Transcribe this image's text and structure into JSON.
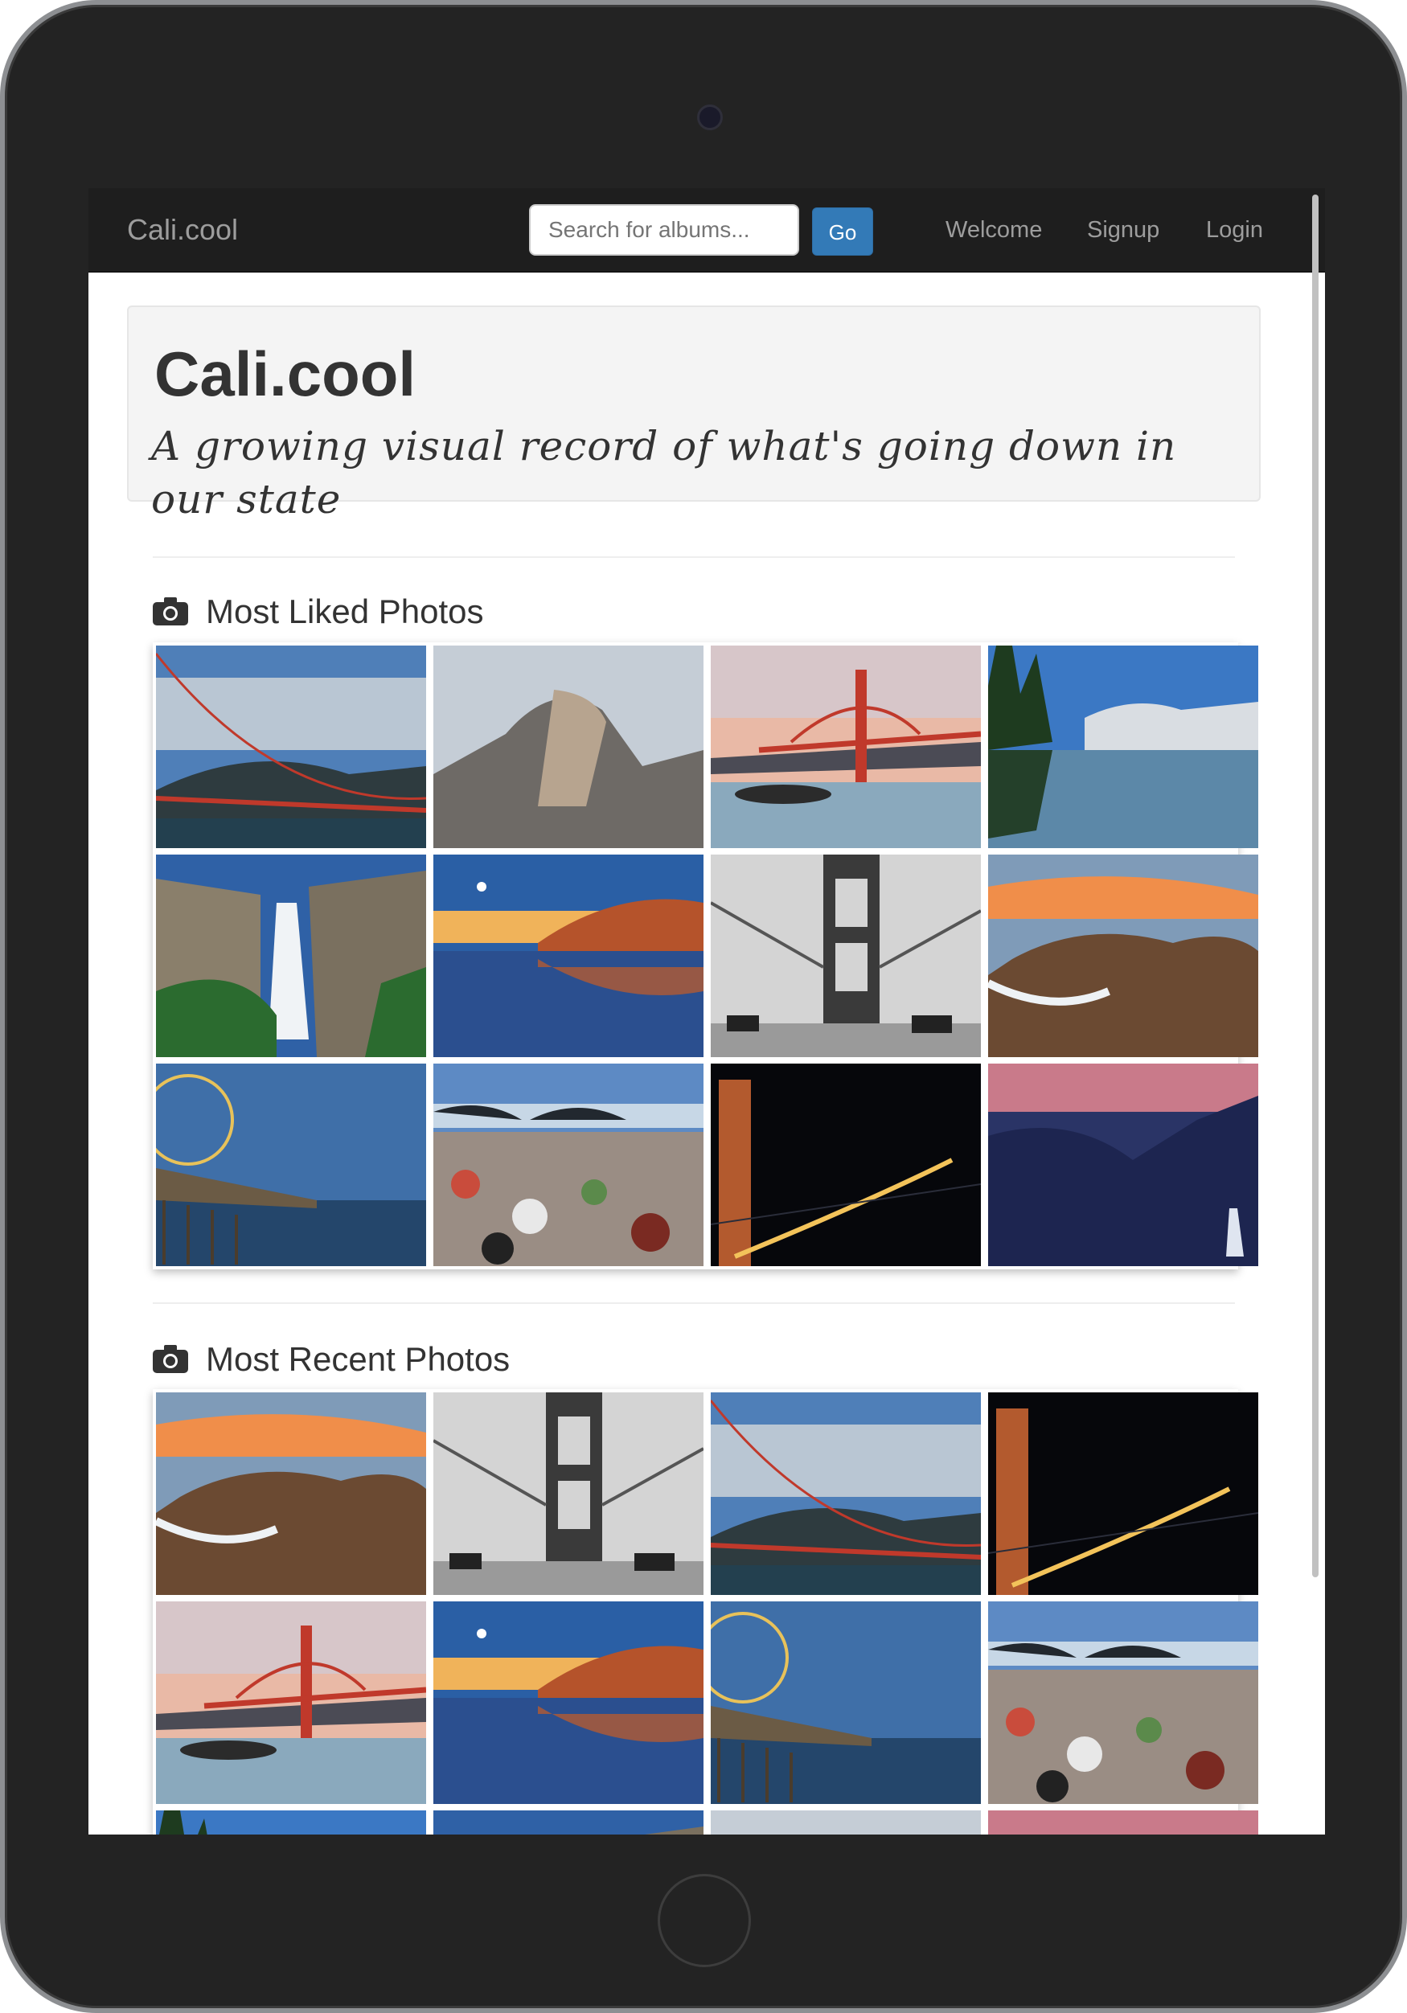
{
  "navbar": {
    "brand": "Cali.cool",
    "search_placeholder": "Search for albums...",
    "go_label": "Go",
    "links": [
      "Welcome",
      "Signup",
      "Login"
    ]
  },
  "jumbotron": {
    "title": "Cali.cool",
    "subtitle": "A growing visual record of what's going down in our state"
  },
  "sections": [
    {
      "icon": "camera-icon",
      "title": "Most Liked Photos",
      "photos": [
        "bridge-clouds",
        "half-dome",
        "bridge-sunset-beach",
        "mountain-lake",
        "waterfall",
        "beach-reflection",
        "bridge-bw",
        "rocky-coast",
        "pier-ferris-wheel",
        "glass-beach",
        "bridge-night",
        "valley-dusk"
      ]
    },
    {
      "icon": "camera-icon",
      "title": "Most Recent Photos",
      "photos": [
        "rocky-coast",
        "bridge-bw",
        "bridge-clouds",
        "bridge-night",
        "bridge-sunset-beach",
        "beach-reflection",
        "pier-ferris-wheel",
        "glass-beach",
        "mountain-lake",
        "waterfall",
        "half-dome",
        "valley-dusk"
      ]
    }
  ]
}
